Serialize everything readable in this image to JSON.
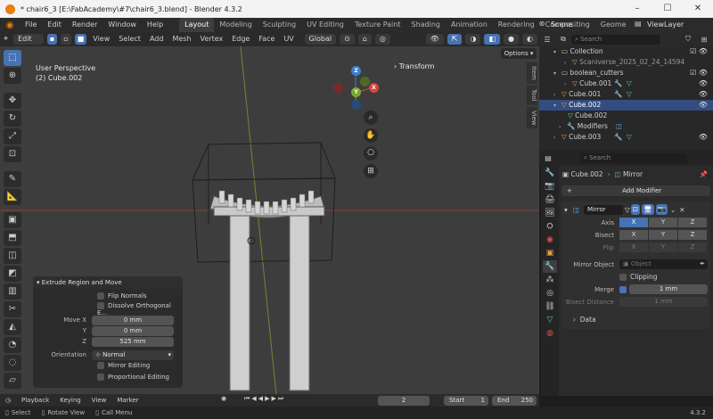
{
  "titlebar": {
    "title": "* chair6_3 [E:\\FabAcademy\\#7\\chair6_3.blend] - Blender 4.3.2"
  },
  "menus": [
    "File",
    "Edit",
    "Render",
    "Window",
    "Help"
  ],
  "workspaces": [
    "Layout",
    "Modeling",
    "Sculpting",
    "UV Editing",
    "Texture Paint",
    "Shading",
    "Animation",
    "Rendering",
    "Compositing",
    "Geome"
  ],
  "scene": "Scene",
  "viewlayer": "ViewLayer",
  "header": {
    "mode": "Edit Mode",
    "menus": [
      "View",
      "Select",
      "Add",
      "Mesh",
      "Vertex",
      "Edge",
      "Face",
      "UV"
    ],
    "orientation": "Global",
    "options": "Options"
  },
  "viewport": {
    "line1": "User Perspective",
    "line2": "(2) Cube.002",
    "transform": "Transform",
    "gizmo": {
      "x": "X",
      "y": "Y",
      "z": "Z"
    }
  },
  "vtabs": [
    "Item",
    "Tool",
    "View"
  ],
  "redo": {
    "title": "Extrude Region and Move",
    "flip_normals": "Flip Normals",
    "dissolve": "Dissolve Orthogonal E...",
    "move_x_label": "Move X",
    "move_x": "0 mm",
    "y_label": "Y",
    "y": "0 mm",
    "z_label": "Z",
    "z": "525 mm",
    "orientation_label": "Orientation",
    "orientation": "Normal",
    "mirror_editing": "Mirror Editing",
    "proportional_editing": "Proportional Editing"
  },
  "timeline": {
    "playback": "Playback",
    "keying": "Keying",
    "view": "View",
    "marker": "Marker",
    "frame": "2",
    "start_label": "Start",
    "start": "1",
    "end_label": "End",
    "end": "250"
  },
  "outliner": {
    "search_placeholder": "Search",
    "items": [
      "Collection",
      "Scaniverse_2025_02_24_14594",
      "boolean_cutters",
      "Cube.001",
      "Cube.001",
      "Cube.002",
      "Cube.002",
      "Modifiers",
      "Cube.003"
    ]
  },
  "props": {
    "search_placeholder": "Search",
    "breadcrumb_obj": "Cube.002",
    "breadcrumb_mod": "Mirror",
    "add_modifier": "Add Modifier",
    "modifier_name": "Mirror",
    "axis": "Axis",
    "bisect": "Bisect",
    "flip": "Flip",
    "x": "X",
    "y": "Y",
    "z": "Z",
    "mirror_object": "Mirror Object",
    "object_placeholder": "Object",
    "clipping": "Clipping",
    "merge": "Merge",
    "merge_value": "1 mm",
    "bisect_distance": "Bisect Distance",
    "bisect_distance_value": "1 mm",
    "data": "Data"
  },
  "status": {
    "select": "Select",
    "rotate": "Rotate View",
    "call": "Call Menu",
    "version": "4.3.2"
  }
}
